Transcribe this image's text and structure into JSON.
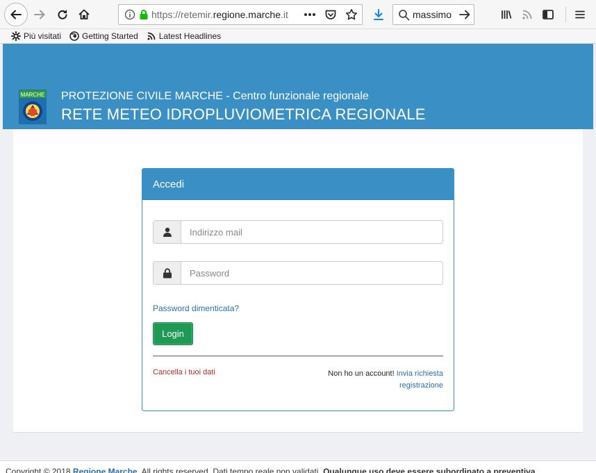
{
  "browser": {
    "url_prefix": "https://retemir.",
    "url_domain": "regione.marche",
    "url_suffix": ".it",
    "search_query": "massimo t",
    "bookmarks": [
      {
        "label": "Più visitati",
        "icon": "gear-icon"
      },
      {
        "label": "Getting Started",
        "icon": "firefox-icon"
      },
      {
        "label": "Latest Headlines",
        "icon": "rss-icon"
      }
    ]
  },
  "header": {
    "logo_text": "MARCHE",
    "org_name": "PROTEZIONE CIVILE MARCHE - Centro funzionale regionale",
    "title": "RETE METEO IDROPLUVIOMETRICA REGIONALE",
    "brand_color": "#3a8fc4"
  },
  "login": {
    "heading": "Accedi",
    "email_placeholder": "Indirizzo mail",
    "password_placeholder": "Password",
    "forgot_label": "Password dimenticata?",
    "login_label": "Login",
    "cancel_label": "Cancella i tuoi dati",
    "no_account_text": "Non ho un account!",
    "request_label": "Invia richiesta registrazione",
    "button_color": "#1f9a54"
  },
  "footer": {
    "prefix": "Copyright © 2018 ",
    "link": "Regione Marche",
    "middle": ". All rights reserved. Dati tempo reale non validati. ",
    "bold": "Qualunque uso deve essere subordinato a preventiva"
  }
}
